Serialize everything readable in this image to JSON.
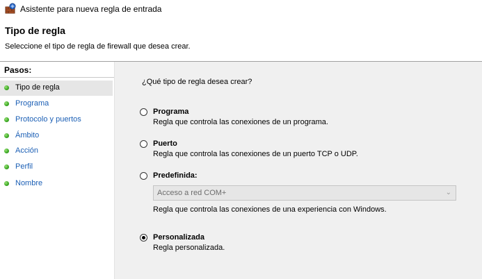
{
  "window": {
    "title": "Asistente para nueva regla de entrada",
    "icon": "firewall-wizard-icon"
  },
  "header": {
    "title": "Tipo de regla",
    "description": "Seleccione el tipo de regla de firewall que desea crear."
  },
  "sidebar": {
    "heading": "Pasos:",
    "steps": [
      {
        "label": "Tipo de regla",
        "current": true
      },
      {
        "label": "Programa",
        "current": false
      },
      {
        "label": "Protocolo y puertos",
        "current": false
      },
      {
        "label": "Ámbito",
        "current": false
      },
      {
        "label": "Acción",
        "current": false
      },
      {
        "label": "Perfil",
        "current": false
      },
      {
        "label": "Nombre",
        "current": false
      }
    ]
  },
  "content": {
    "question": "¿Qué tipo de regla desea crear?",
    "options": [
      {
        "title": "Programa",
        "description": "Regla que controla las conexiones de un programa.",
        "selected": false
      },
      {
        "title": "Puerto",
        "description": "Regla que controla las conexiones de un puerto TCP o UDP.",
        "selected": false
      },
      {
        "title": "Predefinida:",
        "description": "Regla que controla las conexiones de una experiencia con Windows.",
        "selected": false
      },
      {
        "title": "Personalizada",
        "description": "Regla personalizada.",
        "selected": true
      }
    ],
    "predefined_select": {
      "value": "Acceso a red COM+",
      "enabled": false
    }
  },
  "colors": {
    "content_bg": "#f0f0f0",
    "link": "#1b5fb5",
    "step_dot": "#3aa821"
  }
}
